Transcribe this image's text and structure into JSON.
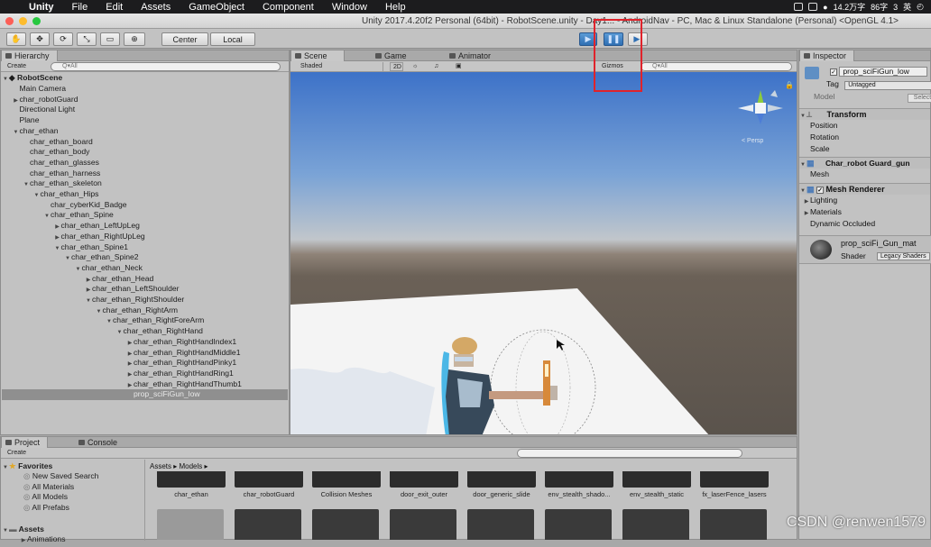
{
  "menubar": {
    "app": "Unity",
    "items": [
      "File",
      "Edit",
      "Assets",
      "GameObject",
      "Component",
      "Window",
      "Help"
    ],
    "status": [
      "14.2万字",
      "86字",
      "3",
      "英"
    ]
  },
  "window": {
    "title": "Unity 2017.4.20f2 Personal (64bit) - RobotScene.unity - Day1... - AndroidNav - PC, Mac & Linux Standalone (Personal) <OpenGL 4.1>"
  },
  "toolbar": {
    "pivot_label": "Center",
    "space_label": "Local"
  },
  "hierarchy": {
    "tab": "Hierarchy",
    "create": "Create",
    "search_placeholder": "Q▾All",
    "scene_name": "RobotScene",
    "rows": [
      {
        "label": "Main Camera",
        "indent": 1,
        "arrow": ""
      },
      {
        "label": "char_robotGuard",
        "indent": 1,
        "arrow": "▶"
      },
      {
        "label": "Directional Light",
        "indent": 1,
        "arrow": ""
      },
      {
        "label": "Plane",
        "indent": 1,
        "arrow": ""
      },
      {
        "label": "char_ethan",
        "indent": 1,
        "arrow": "▼"
      },
      {
        "label": "char_ethan_board",
        "indent": 2,
        "arrow": ""
      },
      {
        "label": "char_ethan_body",
        "indent": 2,
        "arrow": ""
      },
      {
        "label": "char_ethan_glasses",
        "indent": 2,
        "arrow": ""
      },
      {
        "label": "char_ethan_harness",
        "indent": 2,
        "arrow": ""
      },
      {
        "label": "char_ethan_skeleton",
        "indent": 2,
        "arrow": "▼"
      },
      {
        "label": "char_ethan_Hips",
        "indent": 3,
        "arrow": "▼"
      },
      {
        "label": "char_cyberKid_Badge",
        "indent": 4,
        "arrow": ""
      },
      {
        "label": "char_ethan_Spine",
        "indent": 4,
        "arrow": "▼"
      },
      {
        "label": "char_ethan_LeftUpLeg",
        "indent": 5,
        "arrow": "▶"
      },
      {
        "label": "char_ethan_RightUpLeg",
        "indent": 5,
        "arrow": "▶"
      },
      {
        "label": "char_ethan_Spine1",
        "indent": 5,
        "arrow": "▼"
      },
      {
        "label": "char_ethan_Spine2",
        "indent": 6,
        "arrow": "▼"
      },
      {
        "label": "char_ethan_Neck",
        "indent": 7,
        "arrow": "▼"
      },
      {
        "label": "char_ethan_Head",
        "indent": 8,
        "arrow": "▶"
      },
      {
        "label": "char_ethan_LeftShoulder",
        "indent": 8,
        "arrow": "▶"
      },
      {
        "label": "char_ethan_RightShoulder",
        "indent": 8,
        "arrow": "▼"
      },
      {
        "label": "char_ethan_RightArm",
        "indent": 9,
        "arrow": "▼"
      },
      {
        "label": "char_ethan_RightForeArm",
        "indent": 10,
        "arrow": "▼"
      },
      {
        "label": "char_ethan_RightHand",
        "indent": 11,
        "arrow": "▼"
      },
      {
        "label": "char_ethan_RightHandIndex1",
        "indent": 12,
        "arrow": "▶"
      },
      {
        "label": "char_ethan_RightHandMiddle1",
        "indent": 12,
        "arrow": "▶"
      },
      {
        "label": "char_ethan_RightHandPinky1",
        "indent": 12,
        "arrow": "▶"
      },
      {
        "label": "char_ethan_RightHandRing1",
        "indent": 12,
        "arrow": "▶"
      },
      {
        "label": "char_ethan_RightHandThumb1",
        "indent": 12,
        "arrow": "▶"
      },
      {
        "label": "prop_sciFiGun_low",
        "indent": 12,
        "arrow": "",
        "selected": true
      }
    ]
  },
  "scene": {
    "tabs": [
      "Scene",
      "Game",
      "Animator"
    ],
    "shading": "Shaded",
    "mode_2d": "2D",
    "gizmos": "Gizmos",
    "search_placeholder": "Q▾All",
    "persp": "< Persp"
  },
  "inspector": {
    "tab": "Inspector",
    "object_name": "prop_sciFiGun_low",
    "tag_label": "Tag",
    "tag_value": "Untagged",
    "model_label": "Model",
    "model_select": "Select",
    "transform": {
      "title": "Transform",
      "fields": [
        "Position",
        "Rotation",
        "Scale"
      ]
    },
    "mesh_filter": {
      "title": "Char_robot Guard_gun",
      "field": "Mesh"
    },
    "mesh_renderer": {
      "title": "Mesh Renderer",
      "fields": [
        "Lighting",
        "Materials",
        "Dynamic Occluded"
      ]
    },
    "material": {
      "name": "prop_sciFi_Gun_mat",
      "shader_label": "Shader",
      "shader_value": "Legacy Shaders"
    }
  },
  "project": {
    "tabs": [
      "Project",
      "Console"
    ],
    "create": "Create",
    "favorites_label": "Favorites",
    "favorites": [
      "New Saved Search",
      "All Materials",
      "All Models",
      "All Prefabs"
    ],
    "assets_label": "Assets",
    "assets_children": [
      "Animations"
    ],
    "breadcrumb": [
      "Assets",
      "Models"
    ],
    "row1": [
      "char_ethan",
      "char_robotGuard",
      "Collision Meshes",
      "door_exit_outer",
      "door_generic_slide",
      "env_stealth_shado...",
      "env_stealth_static",
      "fx_laserFence_lasers"
    ]
  },
  "watermark": "CSDN @renwen1579",
  "colors": {
    "play_blue": "#3a7bc8",
    "highlight_red": "#e0232b",
    "selection": "#8f8f8f"
  }
}
